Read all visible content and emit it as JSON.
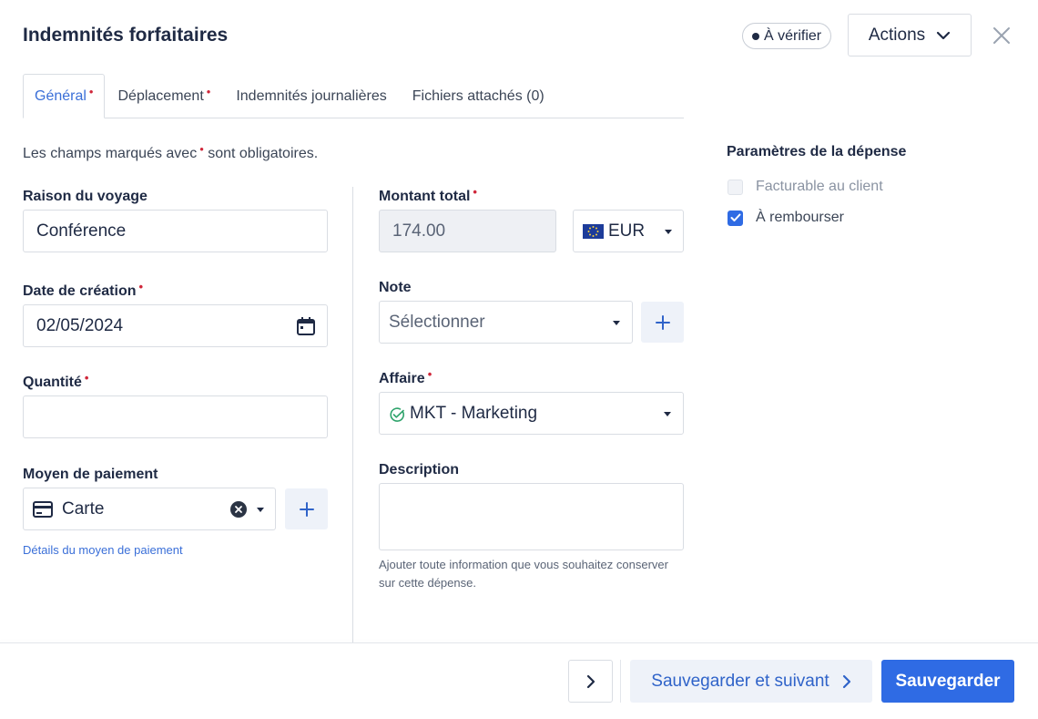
{
  "header": {
    "title": "Indemnités forfaitaires",
    "status": "À vérifier",
    "actions_label": "Actions"
  },
  "tabs": [
    {
      "label": "Général",
      "required": true,
      "active": true
    },
    {
      "label": "Déplacement",
      "required": true,
      "active": false
    },
    {
      "label": "Indemnités journalières",
      "required": false,
      "active": false
    },
    {
      "label": "Fichiers attachés (0)",
      "required": false,
      "active": false
    }
  ],
  "required_marker": "•",
  "mandatory_note": {
    "before": "Les champs marqués avec",
    "after": "sont obligatoires."
  },
  "form": {
    "reason": {
      "label": "Raison du voyage",
      "value": "Conférence"
    },
    "creation_date": {
      "label": "Date de création",
      "value": "02/05/2024"
    },
    "quantity": {
      "label": "Quantité",
      "value": ""
    },
    "payment_method": {
      "label": "Moyen de paiement",
      "value": "Carte",
      "details_link": "Détails du moyen de paiement"
    },
    "total_amount": {
      "label": "Montant total",
      "value": "174.00",
      "currency": "EUR"
    },
    "note": {
      "label": "Note",
      "placeholder": "Sélectionner"
    },
    "affaire": {
      "label": "Affaire",
      "value": "MKT - Marketing"
    },
    "description": {
      "label": "Description",
      "value": "",
      "help": "Ajouter toute information que vous souhaitez conserver sur cette dépense."
    }
  },
  "params": {
    "title": "Paramètres de la dépense",
    "billable": {
      "label": "Facturable au client",
      "checked": false
    },
    "reimburse": {
      "label": "À rembourser",
      "checked": true
    }
  },
  "footer": {
    "save_next_label": "Sauvegarder et suivant",
    "save_label": "Sauvegarder"
  },
  "colors": {
    "accent": "#2f6be4",
    "required": "#d0283b",
    "link": "#3a6fd8"
  }
}
